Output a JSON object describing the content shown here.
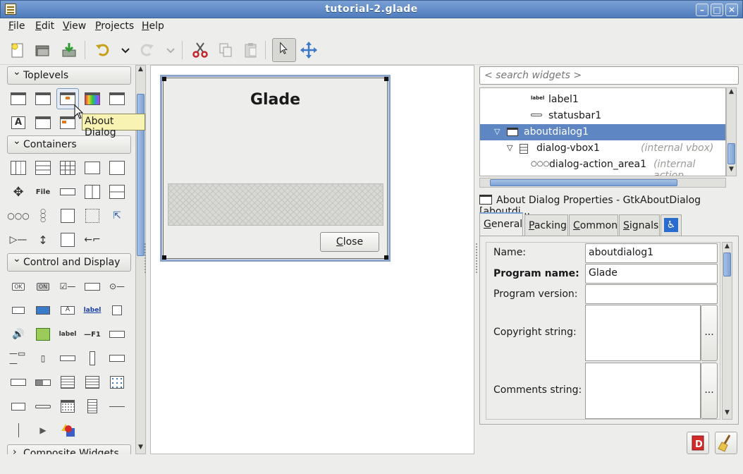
{
  "window": {
    "title": "tutorial-2.glade"
  },
  "menubar": {
    "items": [
      {
        "label": "File",
        "mnemonic": "F",
        "rest": "ile"
      },
      {
        "label": "Edit",
        "mnemonic": "E",
        "rest": "dit"
      },
      {
        "label": "View",
        "mnemonic": "V",
        "rest": "iew"
      },
      {
        "label": "Projects",
        "mnemonic": "P",
        "rest": "rojects"
      },
      {
        "label": "Help",
        "mnemonic": "H",
        "rest": "elp"
      }
    ]
  },
  "palette": {
    "sections": [
      {
        "label": "Toplevels"
      },
      {
        "label": "Containers"
      },
      {
        "label": "Control and Display"
      },
      {
        "label": "Composite Widgets"
      }
    ],
    "tooltip": "About Dialog",
    "icon_texts": {
      "ok": "OK",
      "on": "ON",
      "label": "label",
      "label2": "label",
      "f1": "—F1",
      "file": "File",
      "A": "A",
      "A2": "A"
    }
  },
  "canvas": {
    "dialog_title": "Glade",
    "close_button": "Close",
    "close_mnemonic": "C",
    "close_rest": "lose"
  },
  "inspector": {
    "search_placeholder": "< search widgets >",
    "tree": [
      {
        "label": "label1",
        "extra": "",
        "icon": "label-icon"
      },
      {
        "label": "statusbar1",
        "extra": "",
        "icon": "statusbar-icon"
      },
      {
        "label": "aboutdialog1",
        "extra": "",
        "icon": "about-dialog-icon",
        "selected": true
      },
      {
        "label": "dialog-vbox1",
        "extra": "(internal vbox)",
        "icon": "vbox-icon"
      },
      {
        "label": "dialog-action_area1",
        "extra": "(internal action",
        "icon": "action-area-icon"
      }
    ],
    "label_icon_text": "label"
  },
  "properties": {
    "header": "About Dialog Properties - GtkAboutDialog [aboutdi...",
    "tabs": [
      {
        "label": "General",
        "mnemonic": "G",
        "rest": "eneral"
      },
      {
        "label": "Packing",
        "mnemonic": "P",
        "rest": "acking"
      },
      {
        "label": "Common",
        "mnemonic": "C",
        "rest": "ommon"
      },
      {
        "label": "Signals",
        "mnemonic": "S",
        "rest": "ignals"
      }
    ],
    "fields": {
      "name_label": "Name:",
      "name_value": "aboutdialog1",
      "program_name_label": "Program name:",
      "program_name_value": "Glade",
      "program_version_label": "Program version:",
      "program_version_value": "",
      "copyright_label": "Copyright string:",
      "comments_label": "Comments string:",
      "dots": "..."
    }
  }
}
